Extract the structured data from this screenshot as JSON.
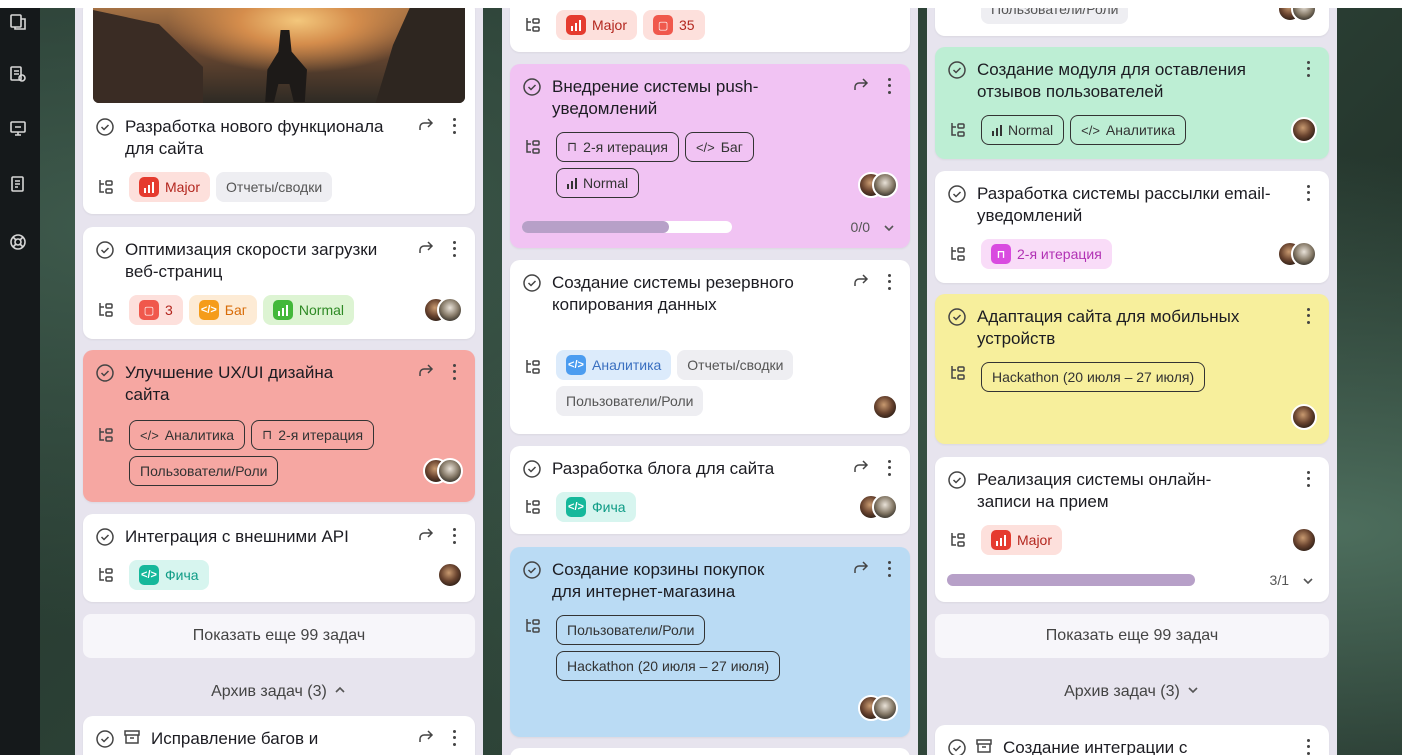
{
  "columns": [
    {
      "cards": [
        {
          "title": "Разработка нового функционала для сайта",
          "tags": [
            "Major",
            "Отчеты/сводки"
          ]
        },
        {
          "title": "Оптимизация скорости загрузки веб-страниц",
          "tags": [
            "3",
            "Баг",
            "Normal"
          ]
        },
        {
          "title": "Улучшение UX/UI дизайна сайта",
          "tags": [
            "Аналитика",
            "2-я итерация",
            "Пользователи/Роли"
          ]
        },
        {
          "title": "Интеграция с внешними API",
          "tags": [
            "Фича"
          ]
        },
        {
          "title": "Исправление багов и"
        }
      ],
      "show_more": "Показать еще 99 задач",
      "archive": "Архив задач (3)"
    },
    {
      "cards": [
        {
          "tags": [
            "Major",
            "35"
          ]
        },
        {
          "title": "Внедрение системы push-уведомлений",
          "tags": [
            "2-я итерация",
            "Баг",
            "Normal"
          ],
          "progress": 0.7,
          "progress_text": "0/0"
        },
        {
          "title": "Создание системы резервного копирования данных",
          "tags": [
            "Аналитика",
            "Отчеты/сводки",
            "Пользователи/Роли"
          ]
        },
        {
          "title": "Разработка блога для сайта",
          "tags": [
            "Фича"
          ]
        },
        {
          "title": "Создание корзины покупок для интернет-магазина",
          "tags": [
            "Пользователи/Роли",
            "Hackathon (20 июля – 27 июля)"
          ]
        }
      ]
    },
    {
      "cards": [
        {
          "tags": [
            "Пользователи/Роли"
          ]
        },
        {
          "title": "Создание модуля для оставления отзывов пользователей",
          "tags": [
            "Normal",
            "Аналитика"
          ]
        },
        {
          "title": "Разработка системы рассылки email-уведомлений",
          "tags": [
            "2-я итерация"
          ]
        },
        {
          "title": "Адаптация сайта для мобильных устройств",
          "tags": [
            "Hackathon (20 июля – 27 июля)"
          ]
        },
        {
          "title": "Реализация системы онлайн-записи на прием",
          "tags": [
            "Major"
          ],
          "progress": 0.85,
          "progress_text": "3/1"
        },
        {
          "title": "Создание интеграции с"
        }
      ],
      "show_more": "Показать еще 99 задач",
      "archive": "Архив задач (3)"
    }
  ],
  "colors": {
    "pink_card": "#f1c3f3",
    "red_card": "#f6a7a2",
    "blue_card": "#badbf4",
    "green_card": "#bdeed4",
    "yellow_card": "#f7ef9c",
    "column_bg": "#e7e4ee"
  },
  "icons": [
    "check-circle-icon",
    "share-icon",
    "more-icon",
    "subtasks-icon",
    "archive-icon",
    "chevron-down-icon",
    "chevron-up-icon"
  ]
}
